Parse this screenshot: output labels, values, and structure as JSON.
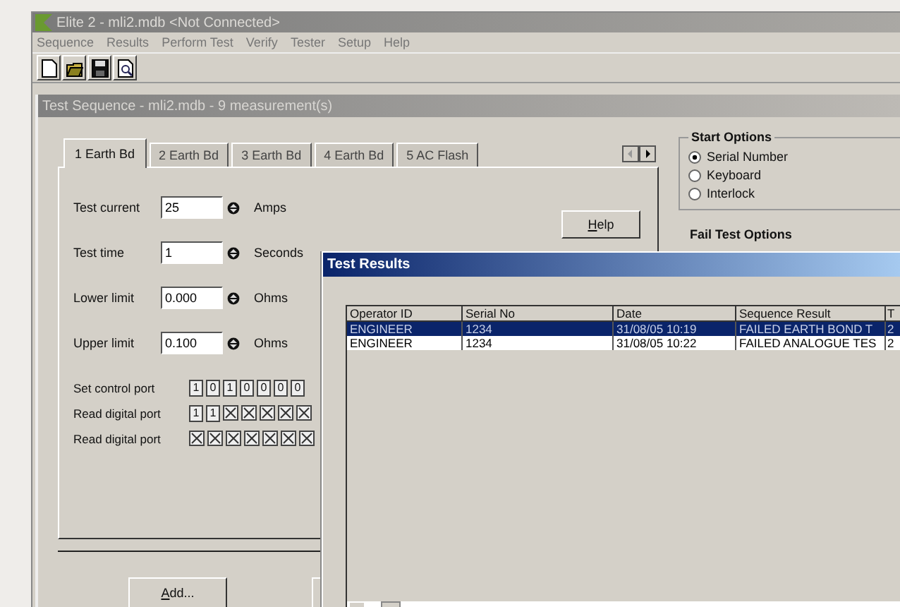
{
  "window": {
    "title": "Elite 2 - mli2.mdb    <Not Connected>"
  },
  "menu": [
    "Sequence",
    "Results",
    "Perform Test",
    "Verify",
    "Tester",
    "Setup",
    "Help"
  ],
  "toolbar": [
    {
      "kind": "new"
    },
    {
      "kind": "open"
    },
    {
      "kind": "save"
    },
    {
      "kind": "preview"
    }
  ],
  "child_window": {
    "title": "Test Sequence - mli2.mdb - 9 measurement(s)",
    "tabs": [
      {
        "label": "1 Earth Bd",
        "selected": true
      },
      {
        "label": "2 Earth Bd",
        "selected": false
      },
      {
        "label": "3 Earth Bd",
        "selected": false
      },
      {
        "label": "4 Earth Bd",
        "selected": false
      },
      {
        "label": "5 AC Flash",
        "selected": false
      }
    ],
    "fields": [
      {
        "label": "Test current",
        "value": "25",
        "unit": "Amps"
      },
      {
        "label": "Test time",
        "value": "1",
        "unit": "Seconds"
      },
      {
        "label": "Lower limit",
        "value": "0.000",
        "unit": "Ohms"
      },
      {
        "label": "Upper limit",
        "value": "0.100",
        "unit": "Ohms"
      }
    ],
    "help_button": "Help",
    "ports": [
      {
        "label": "Set control port",
        "bits": [
          {
            "kind": "value",
            "text": "1"
          },
          {
            "kind": "value",
            "text": "0"
          },
          {
            "kind": "value",
            "text": "1"
          },
          {
            "kind": "value",
            "text": "0"
          },
          {
            "kind": "value",
            "text": "0"
          },
          {
            "kind": "value",
            "text": "0"
          },
          {
            "kind": "value",
            "text": "0"
          }
        ]
      },
      {
        "label": "Read digital port",
        "bits": [
          {
            "kind": "value",
            "text": "1"
          },
          {
            "kind": "value",
            "text": "1"
          },
          {
            "kind": "cross"
          },
          {
            "kind": "cross"
          },
          {
            "kind": "cross"
          },
          {
            "kind": "cross"
          },
          {
            "kind": "cross"
          }
        ]
      },
      {
        "label": "Read digital port",
        "bits": [
          {
            "kind": "cross"
          },
          {
            "kind": "cross"
          },
          {
            "kind": "cross"
          },
          {
            "kind": "cross"
          },
          {
            "kind": "cross"
          },
          {
            "kind": "cross"
          },
          {
            "kind": "cross"
          }
        ]
      }
    ],
    "add_button": "Add...",
    "start_options": {
      "title": "Start Options",
      "options": [
        {
          "label": "Serial Number",
          "selected": true
        },
        {
          "label": "Keyboard",
          "selected": false
        },
        {
          "label": "Interlock",
          "selected": false
        }
      ]
    },
    "fail_options": {
      "title": "Fail Test Options"
    }
  },
  "dialog": {
    "title": "Test Results",
    "columns": [
      "Operator ID",
      "Serial No",
      "Date",
      "Sequence Result",
      "T"
    ],
    "rows": [
      {
        "selected": true,
        "cells": [
          "ENGINEER",
          "1234",
          "31/08/05 10:19",
          "FAILED EARTH BOND T",
          "2"
        ]
      },
      {
        "selected": false,
        "cells": [
          "ENGINEER",
          "1234",
          "31/08/05 10:22",
          "FAILED ANALOGUE TES",
          "2"
        ]
      }
    ]
  }
}
